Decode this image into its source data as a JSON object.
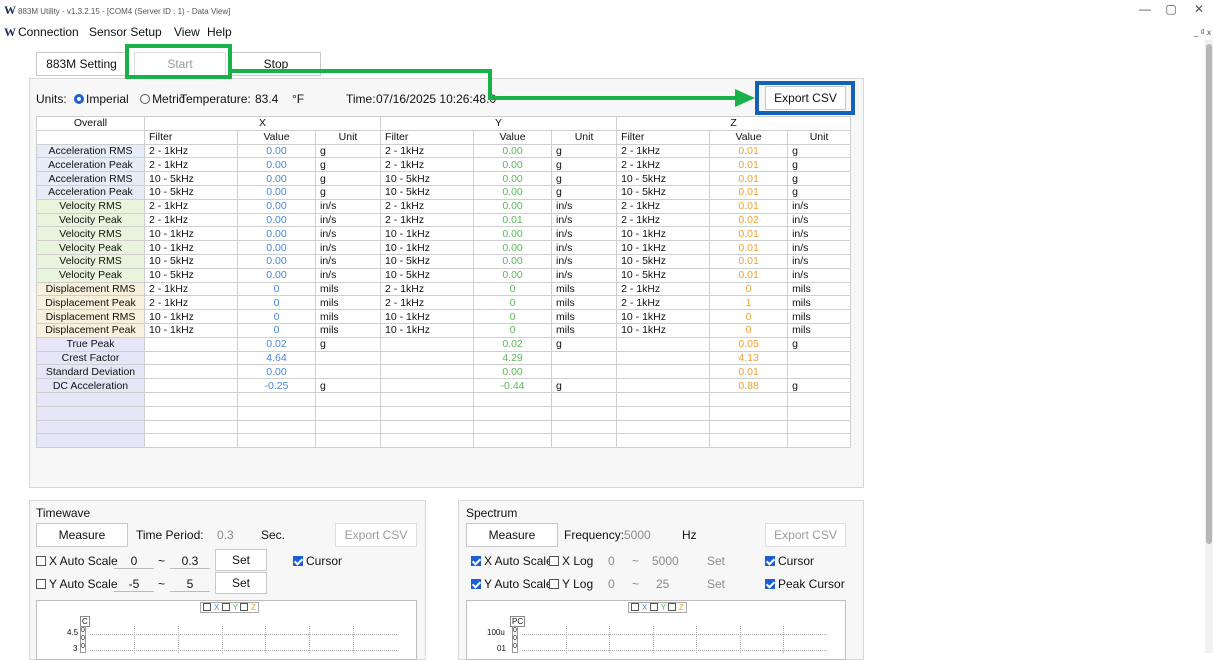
{
  "window": {
    "title": "883M Utility - v1.3.2.15 - [COM4 (Server ID : 1) - Data View]",
    "logo": "W",
    "minimize": "—",
    "restore": "▢",
    "close": "✕",
    "mdi": "_ ₫ x"
  },
  "menu": [
    "Connection",
    "Sensor Setup",
    "View",
    "Help"
  ],
  "toolbar": {
    "setting": "883M Setting",
    "start": "Start",
    "stop": "Stop"
  },
  "status": {
    "units_label": "Units:",
    "imperial": "Imperial",
    "metric": "Metric",
    "temp_label": "Temperature:",
    "temp_value": "83.4",
    "temp_unit": "°F",
    "time_label": "Time:",
    "time_value": "07/16/2025  10:26:48.0",
    "export": "Export CSV"
  },
  "table": {
    "corner": "Overall",
    "axes": [
      "X",
      "Y",
      "Z"
    ],
    "subheaders": [
      "Filter",
      "Value",
      "Unit"
    ],
    "rows": [
      {
        "name": "Acceleration RMS",
        "cat": "acc",
        "x": [
          "2 - 1kHz",
          "0.00",
          "g"
        ],
        "y": [
          "2 - 1kHz",
          "0.00",
          "g"
        ],
        "z": [
          "2 - 1kHz",
          "0.01",
          "g"
        ]
      },
      {
        "name": "Acceleration Peak",
        "cat": "acc",
        "x": [
          "2 - 1kHz",
          "0.00",
          "g"
        ],
        "y": [
          "2 - 1kHz",
          "0.00",
          "g"
        ],
        "z": [
          "2 - 1kHz",
          "0.01",
          "g"
        ]
      },
      {
        "name": "Acceleration RMS",
        "cat": "acc",
        "x": [
          "10 - 5kHz",
          "0.00",
          "g"
        ],
        "y": [
          "10 - 5kHz",
          "0.00",
          "g"
        ],
        "z": [
          "10 - 5kHz",
          "0.01",
          "g"
        ]
      },
      {
        "name": "Acceleration Peak",
        "cat": "acc",
        "x": [
          "10 - 5kHz",
          "0.00",
          "g"
        ],
        "y": [
          "10 - 5kHz",
          "0.00",
          "g"
        ],
        "z": [
          "10 - 5kHz",
          "0.01",
          "g"
        ]
      },
      {
        "name": "Velocity RMS",
        "cat": "vel",
        "x": [
          "2 - 1kHz",
          "0.00",
          "in/s"
        ],
        "y": [
          "2 - 1kHz",
          "0.00",
          "in/s"
        ],
        "z": [
          "2 - 1kHz",
          "0.01",
          "in/s"
        ]
      },
      {
        "name": "Velocity Peak",
        "cat": "vel",
        "x": [
          "2 - 1kHz",
          "0.00",
          "in/s"
        ],
        "y": [
          "2 - 1kHz",
          "0.01",
          "in/s"
        ],
        "z": [
          "2 - 1kHz",
          "0.02",
          "in/s"
        ]
      },
      {
        "name": "Velocity RMS",
        "cat": "vel",
        "x": [
          "10 - 1kHz",
          "0.00",
          "in/s"
        ],
        "y": [
          "10 - 1kHz",
          "0.00",
          "in/s"
        ],
        "z": [
          "10 - 1kHz",
          "0.01",
          "in/s"
        ]
      },
      {
        "name": "Velocity Peak",
        "cat": "vel",
        "x": [
          "10 - 1kHz",
          "0.00",
          "in/s"
        ],
        "y": [
          "10 - 1kHz",
          "0.00",
          "in/s"
        ],
        "z": [
          "10 - 1kHz",
          "0.01",
          "in/s"
        ]
      },
      {
        "name": "Velocity RMS",
        "cat": "vel",
        "x": [
          "10 - 5kHz",
          "0.00",
          "in/s"
        ],
        "y": [
          "10 - 5kHz",
          "0.00",
          "in/s"
        ],
        "z": [
          "10 - 5kHz",
          "0.01",
          "in/s"
        ]
      },
      {
        "name": "Velocity Peak",
        "cat": "vel",
        "x": [
          "10 - 5kHz",
          "0.00",
          "in/s"
        ],
        "y": [
          "10 - 5kHz",
          "0.00",
          "in/s"
        ],
        "z": [
          "10 - 5kHz",
          "0.01",
          "in/s"
        ]
      },
      {
        "name": "Displacement RMS",
        "cat": "dis",
        "x": [
          "2 - 1kHz",
          "0",
          "mils"
        ],
        "y": [
          "2 - 1kHz",
          "0",
          "mils"
        ],
        "z": [
          "2 - 1kHz",
          "0",
          "mils"
        ]
      },
      {
        "name": "Displacement Peak",
        "cat": "dis",
        "x": [
          "2 - 1kHz",
          "0",
          "mils"
        ],
        "y": [
          "2 - 1kHz",
          "0",
          "mils"
        ],
        "z": [
          "2 - 1kHz",
          "1",
          "mils"
        ]
      },
      {
        "name": "Displacement RMS",
        "cat": "dis",
        "x": [
          "10 - 1kHz",
          "0",
          "mils"
        ],
        "y": [
          "10 - 1kHz",
          "0",
          "mils"
        ],
        "z": [
          "10 - 1kHz",
          "0",
          "mils"
        ]
      },
      {
        "name": "Displacement Peak",
        "cat": "dis",
        "x": [
          "10 - 1kHz",
          "0",
          "mils"
        ],
        "y": [
          "10 - 1kHz",
          "0",
          "mils"
        ],
        "z": [
          "10 - 1kHz",
          "0",
          "mils"
        ]
      },
      {
        "name": "True Peak",
        "cat": "oth",
        "x": [
          "",
          "0.02",
          "g"
        ],
        "y": [
          "",
          "0.02",
          "g"
        ],
        "z": [
          "",
          "0.05",
          "g"
        ]
      },
      {
        "name": "Crest Factor",
        "cat": "oth",
        "x": [
          "",
          "4.64",
          ""
        ],
        "y": [
          "",
          "4.29",
          ""
        ],
        "z": [
          "",
          "4.13",
          ""
        ]
      },
      {
        "name": "Standard Deviation",
        "cat": "oth",
        "x": [
          "",
          "0.00",
          ""
        ],
        "y": [
          "",
          "0.00",
          ""
        ],
        "z": [
          "",
          "0.01",
          ""
        ]
      },
      {
        "name": "DC Acceleration",
        "cat": "oth",
        "x": [
          "",
          "-0.25",
          "g"
        ],
        "y": [
          "",
          "-0.44",
          "g"
        ],
        "z": [
          "",
          "0.88",
          "g"
        ]
      },
      {
        "name": "",
        "cat": "emp",
        "x": [
          "",
          "",
          ""
        ],
        "y": [
          "",
          "",
          ""
        ],
        "z": [
          "",
          "",
          ""
        ]
      },
      {
        "name": "",
        "cat": "emp",
        "x": [
          "",
          "",
          ""
        ],
        "y": [
          "",
          "",
          ""
        ],
        "z": [
          "",
          "",
          ""
        ]
      },
      {
        "name": "",
        "cat": "emp",
        "x": [
          "",
          "",
          ""
        ],
        "y": [
          "",
          "",
          ""
        ],
        "z": [
          "",
          "",
          ""
        ]
      },
      {
        "name": "",
        "cat": "emp",
        "x": [
          "",
          "",
          ""
        ],
        "y": [
          "",
          "",
          ""
        ],
        "z": [
          "",
          "",
          ""
        ]
      }
    ]
  },
  "timewave": {
    "title": "Timewave",
    "measure": "Measure",
    "period_label": "Time Period:",
    "period_value": "0.3",
    "period_unit": "Sec.",
    "export": "Export CSV",
    "x_auto": "X Auto Scale",
    "x_min": "0",
    "tilde": "~",
    "x_max": "0.3",
    "set": "Set",
    "cursor": "Cursor",
    "y_auto": "Y Auto Scale",
    "y_min": "-5",
    "y_max": "5",
    "legend": [
      "X",
      "Y",
      "Z"
    ],
    "axis_tag": "C",
    "y_ticks": [
      "4.5",
      "3"
    ],
    "zeros": [
      "0",
      "0",
      "0"
    ]
  },
  "spectrum": {
    "title": "Spectrum",
    "measure": "Measure",
    "freq_label": "Frequency:",
    "freq_value": "5000",
    "freq_unit": "Hz",
    "export": "Export CSV",
    "x_auto": "X Auto Scale",
    "x_log": "X Log",
    "x_min": "0",
    "tilde": "~",
    "x_max": "5000",
    "set": "Set",
    "cursor": "Cursor",
    "y_auto": "Y Auto Scale",
    "y_log": "Y Log",
    "y_min": "0",
    "y_max": "25",
    "peak_cursor": "Peak Cursor",
    "legend": [
      "X",
      "Y",
      "Z"
    ],
    "axis_tag": "PC",
    "y_ticks": [
      "100u",
      "01"
    ],
    "zeros": [
      "0",
      "0",
      "0"
    ]
  },
  "colors": {
    "x": "#4a86d8",
    "y": "#5cb85c",
    "z": "#f0a030",
    "highlight_green": "#19b24a",
    "highlight_blue": "#1461b8"
  }
}
